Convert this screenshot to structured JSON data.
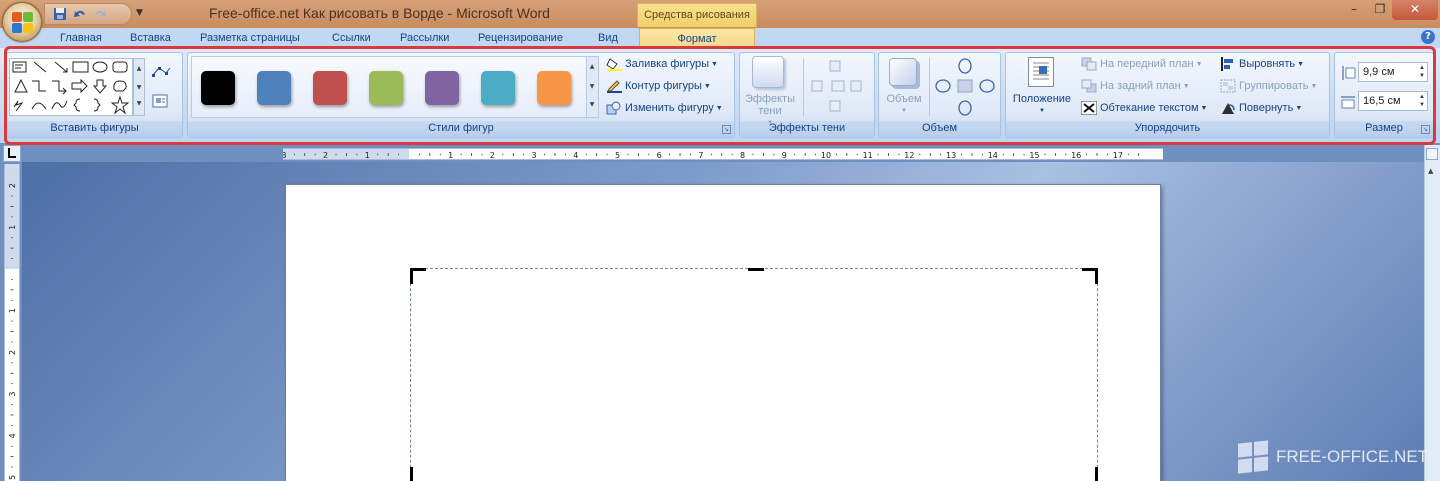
{
  "window": {
    "title": "Free-office.net Как рисовать в Ворде - Microsoft Word",
    "contextual_tab": "Средства рисования",
    "controls": {
      "minimize": "–",
      "maximize": "❐",
      "close": "✕"
    }
  },
  "tabs": [
    "Главная",
    "Вставка",
    "Разметка страницы",
    "Ссылки",
    "Рассылки",
    "Рецензирование",
    "Вид"
  ],
  "active_tab": "Формат",
  "groups": {
    "insert_shapes": "Вставить фигуры",
    "shape_styles": "Стили фигур",
    "shadow_effects": "Эффекты тени",
    "volume": "Объем",
    "arrange": "Упорядочить",
    "size": "Размер"
  },
  "shape_style_colors": [
    "#000000",
    "#4f81bd",
    "#c0504d",
    "#9bbb59",
    "#8064a2",
    "#4bacc6",
    "#f79646"
  ],
  "style_commands": {
    "fill": "Заливка фигуры",
    "outline": "Контур фигуры",
    "change": "Изменить фигуру"
  },
  "shadow": {
    "effects_line1": "Эффекты",
    "effects_line2": "тени"
  },
  "volume": {
    "label": "Объем"
  },
  "arrange": {
    "position": "Положение",
    "bring_forward": "На передний план",
    "send_backward": "На задний план",
    "wrap_text": "Обтекание текстом",
    "align": "Выровнять",
    "group": "Группировать",
    "rotate": "Повернуть"
  },
  "size": {
    "height": "9,9 см",
    "width": "16,5 см"
  },
  "ruler": {
    "h_labels": [
      "3",
      "2",
      "1",
      "1",
      "2",
      "3",
      "4",
      "5",
      "6",
      "7",
      "8",
      "9",
      "10",
      "11",
      "12",
      "13",
      "14",
      "15",
      "16",
      "17"
    ],
    "v_labels": [
      "2",
      "1",
      "1",
      "2",
      "3",
      "4",
      "5"
    ]
  },
  "watermark": "FREE-OFFICE.NET"
}
